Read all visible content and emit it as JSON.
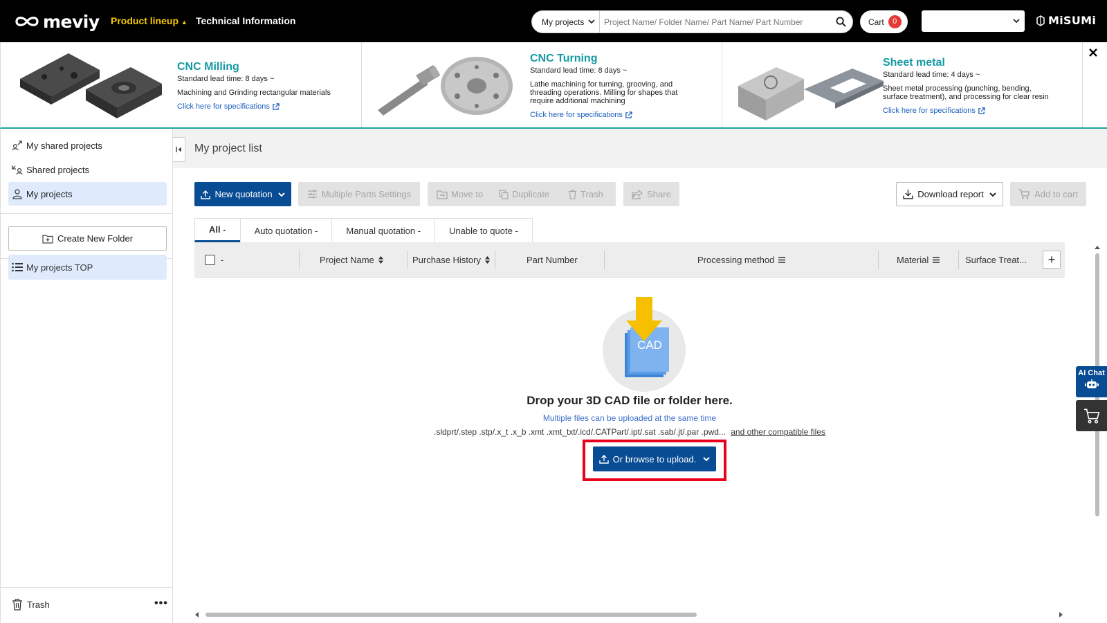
{
  "header": {
    "logo_text": "meviy",
    "nav": {
      "product_lineup": "Product lineup",
      "technical_info": "Technical Information"
    },
    "search": {
      "scope": "My projects",
      "placeholder": "Project Name/ Folder Name/ Part Name/ Part Number"
    },
    "cart": {
      "label": "Cart",
      "count": "0"
    },
    "language_select": {
      "value": ""
    },
    "brand": "MiSUMi"
  },
  "banner": {
    "cards": [
      {
        "title": "CNC Milling",
        "lead_time": "Standard lead time: 8 days ~",
        "description": "Machining and Grinding rectangular materials",
        "link": "Click here for specifications"
      },
      {
        "title": "CNC Turning",
        "lead_time": "Standard lead time: 8 days ~",
        "description": "Lathe machining for turning, grooving, and threading operations. Milling for shapes that require additional machining",
        "link": "Click here for specifications"
      },
      {
        "title": "Sheet metal",
        "lead_time": "Standard lead time: 4 days ~",
        "description": "Sheet metal processing (punching, bending, surface treatment), and processing for clear resin",
        "link": "Click here for specifications"
      }
    ],
    "close_icon": "close-icon"
  },
  "sidebar": {
    "items": [
      {
        "label": "My shared projects",
        "icon": "share-out-icon",
        "active": false
      },
      {
        "label": "Shared projects",
        "icon": "share-in-icon",
        "active": false
      },
      {
        "label": "My projects",
        "icon": "user-icon",
        "active": true
      }
    ],
    "create_folder": "Create New Folder",
    "my_projects_top": "My projects TOP",
    "trash": "Trash",
    "more": "•••"
  },
  "main": {
    "title": "My project list",
    "toolbar": {
      "new_quotation": "New quotation",
      "multiple_parts_settings": "Multiple Parts Settings",
      "move_to": "Move to",
      "duplicate": "Duplicate",
      "trash": "Trash",
      "share": "Share",
      "download_report": "Download report",
      "add_to_cart": "Add to cart"
    },
    "tabs": [
      {
        "label": "All -",
        "active": true
      },
      {
        "label": "Auto quotation -",
        "active": false
      },
      {
        "label": "Manual quotation -",
        "active": false
      },
      {
        "label": "Unable to quote -",
        "active": false
      }
    ],
    "table": {
      "select_all_label": "-",
      "columns": [
        "Project Name",
        "Purchase History",
        "Part Number",
        "Processing method",
        "Material",
        "Surface Treat..."
      ],
      "add_column": "+"
    },
    "dropzone": {
      "cad_label": "CAD",
      "title": "Drop your 3D CAD file or folder here.",
      "subtitle": "Multiple files can be uploaded at the same time",
      "formats": ".sldprt/.step .stp/.x_t .x_b .xmt .xmt_txt/.icd/.CATPart/.ipt/.sat .sab/.jt/.par .pwd...",
      "formats_link": "and other compatible files",
      "browse_button": "Or browse to upload."
    }
  },
  "floating": {
    "ai_chat": "AI Chat"
  },
  "colors": {
    "primary": "#084c94",
    "accent_yellow": "#f5c800",
    "teal": "#1499a3",
    "highlight_red": "#e8001c",
    "badge_red": "#e53935"
  }
}
